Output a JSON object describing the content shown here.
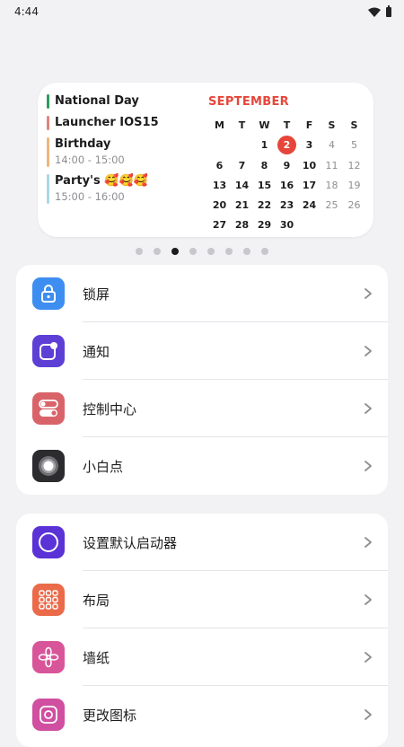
{
  "status_bar": {
    "time": "4:44"
  },
  "widget": {
    "events": [
      {
        "title": "National Day",
        "time": "",
        "color": "#2a9d5c"
      },
      {
        "title": "Launcher IOS15",
        "time": "",
        "color": "#e0857a"
      },
      {
        "title": "Birthday",
        "time": "14:00 - 15:00",
        "color": "#f0b57a"
      },
      {
        "title": "Party's 🥰🥰🥰",
        "time": "15:00 - 16:00",
        "color": "#a8d8e8"
      }
    ],
    "calendar": {
      "month": "SEPTEMBER",
      "weekdays": [
        "M",
        "T",
        "W",
        "T",
        "F",
        "S",
        "S"
      ],
      "today": "2",
      "accent": "#e6463a",
      "weeks": [
        [
          "",
          "",
          "1",
          "2",
          "3",
          "4",
          "5"
        ],
        [
          "6",
          "7",
          "8",
          "9",
          "10",
          "11",
          "12"
        ],
        [
          "13",
          "14",
          "15",
          "16",
          "17",
          "18",
          "19"
        ],
        [
          "20",
          "21",
          "22",
          "23",
          "24",
          "25",
          "26"
        ],
        [
          "27",
          "28",
          "29",
          "30",
          "",
          "",
          ""
        ]
      ]
    }
  },
  "pager": {
    "count": 8,
    "active_index": 2
  },
  "settings_group_1": [
    {
      "label": "锁屏",
      "icon": "lock-icon",
      "color": "#3d8ef0"
    },
    {
      "label": "通知",
      "icon": "notification-icon",
      "color": "#5e3fd6"
    },
    {
      "label": "控制中心",
      "icon": "control-center-icon",
      "color": "#d8646a"
    },
    {
      "label": "小白点",
      "icon": "assistive-touch-icon",
      "color": "#2c2c2e"
    }
  ],
  "settings_group_2": [
    {
      "label": "设置默认启动器",
      "icon": "default-launcher-icon",
      "color": "#5a32d6"
    },
    {
      "label": "布局",
      "icon": "layout-grid-icon",
      "color": "#ea6a4a"
    },
    {
      "label": "墙纸",
      "icon": "wallpaper-flower-icon",
      "color": "#d9559a"
    },
    {
      "label": "更改图标",
      "icon": "change-icon-icon",
      "color": "#d04fa0"
    }
  ]
}
